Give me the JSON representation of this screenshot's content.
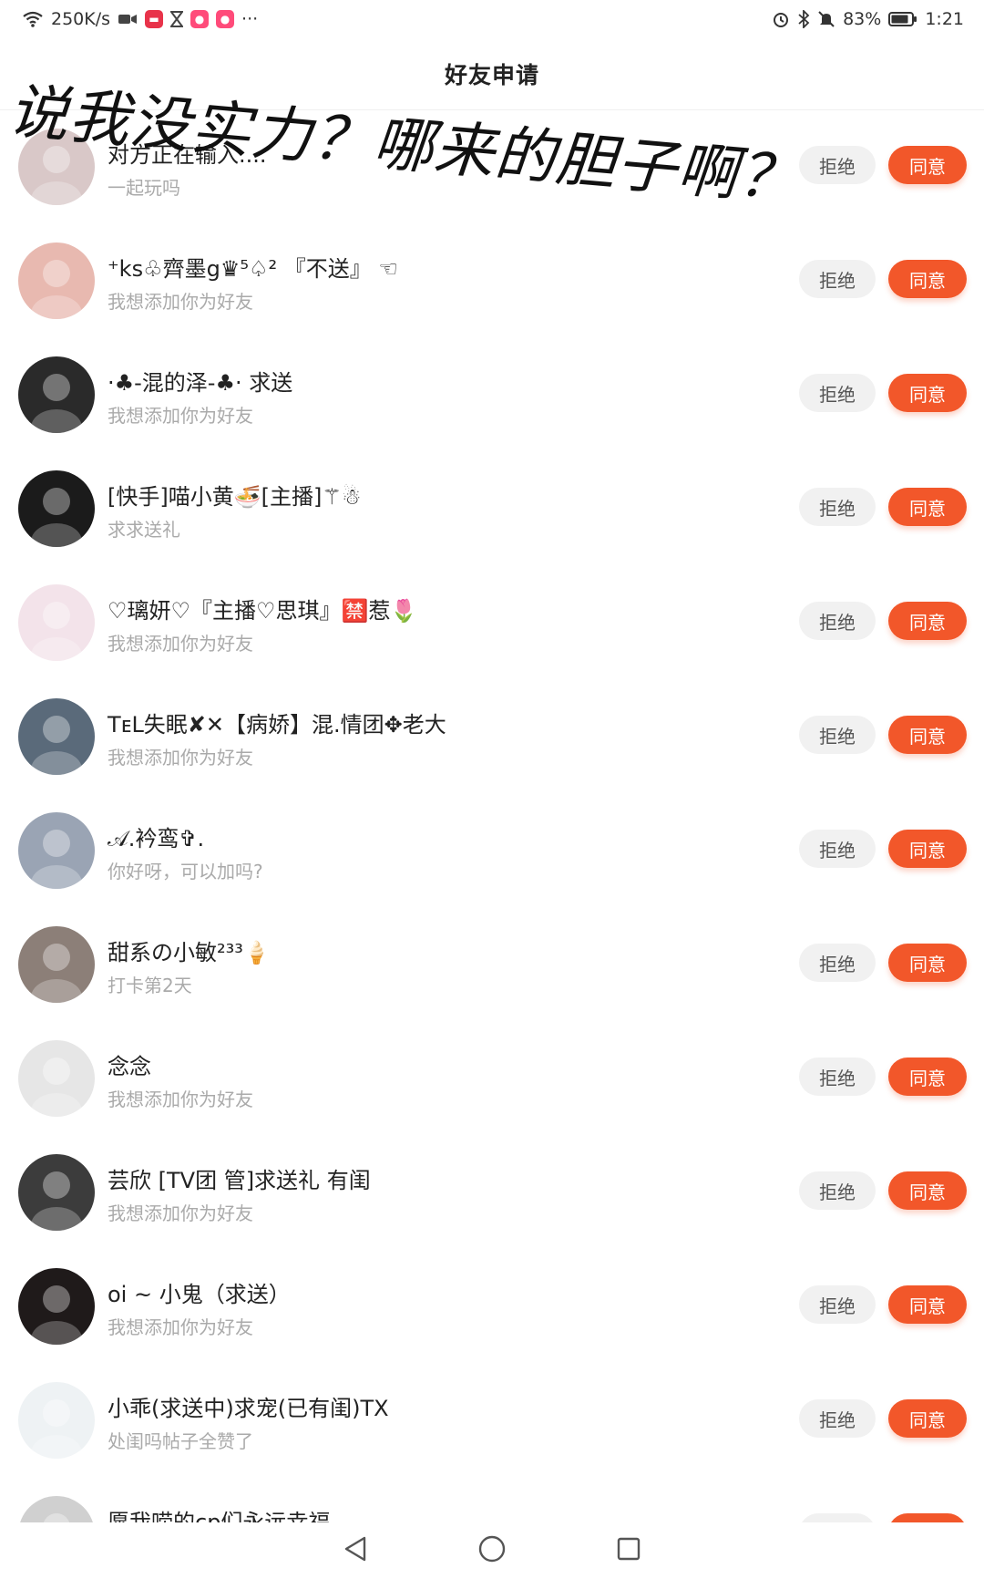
{
  "status_bar": {
    "net_speed": "250K/s",
    "more": "···",
    "battery": "83%",
    "time": "1:21",
    "icons_left": [
      "wifi-icon",
      "video-icon",
      "app-icon",
      "hourglass-icon",
      "app-icon",
      "app-icon"
    ],
    "icons_right": [
      "alarm-icon",
      "bluetooth-icon",
      "mute-icon",
      "battery-icon"
    ]
  },
  "header": {
    "title": "好友申请"
  },
  "overlay": {
    "text": "说我没实力？哪来的胆子啊？"
  },
  "buttons": {
    "reject": "拒绝",
    "accept": "同意"
  },
  "requests": [
    {
      "name": "对方正在输入....",
      "message": "一起玩吗",
      "avatar_color": "#d9c8c8"
    },
    {
      "name": "⁺ks♧齊墨g♛⁵♤² 『不送』 ☜",
      "message": "我想添加你为好友",
      "avatar_color": "#e8b9b0"
    },
    {
      "name": "·♣-混的泽-♣·    求送",
      "message": "我想添加你为好友",
      "avatar_color": "#2a2a2a"
    },
    {
      "name": "[快手]喵小黄🍜[主播]⚚☃",
      "message": "求求送礼",
      "avatar_color": "#1b1b1b"
    },
    {
      "name": "♡璃妍♡『主播♡思琪』🈲惹🌷",
      "message": "我想添加你为好友",
      "avatar_color": "#f3e3ea"
    },
    {
      "name": "TᴇL失眠✘✕【病娇】混.情团✥老大",
      "message": "我想添加你为好友",
      "avatar_color": "#5a6a7a"
    },
    {
      "name": "𝒜.衿鸾✞.",
      "message": "你好呀，可以加吗?",
      "avatar_color": "#9aa4b4"
    },
    {
      "name": "甜系の小敏²³³🍦",
      "message": "打卡第2天",
      "avatar_color": "#8c7f78"
    },
    {
      "name": "念念",
      "message": "我想添加你为好友",
      "avatar_color": "#e6e6e6"
    },
    {
      "name": "芸欣 [TV团 管]求送礼 有闺",
      "message": "我想添加你为好友",
      "avatar_color": "#3c3c3c"
    },
    {
      "name": "oi ~ 小鬼（求送）",
      "message": "我想添加你为好友",
      "avatar_color": "#1f1a1a"
    },
    {
      "name": "小乖(求送中)求宠(已有闺)TX",
      "message": "处闺吗帖子全赞了",
      "avatar_color": "#eef2f4"
    },
    {
      "name": "愿我唠的cp们永远幸福",
      "message": "",
      "avatar_color": "#d0d0d0"
    }
  ],
  "nav": [
    "back-icon",
    "home-icon",
    "recents-icon"
  ]
}
